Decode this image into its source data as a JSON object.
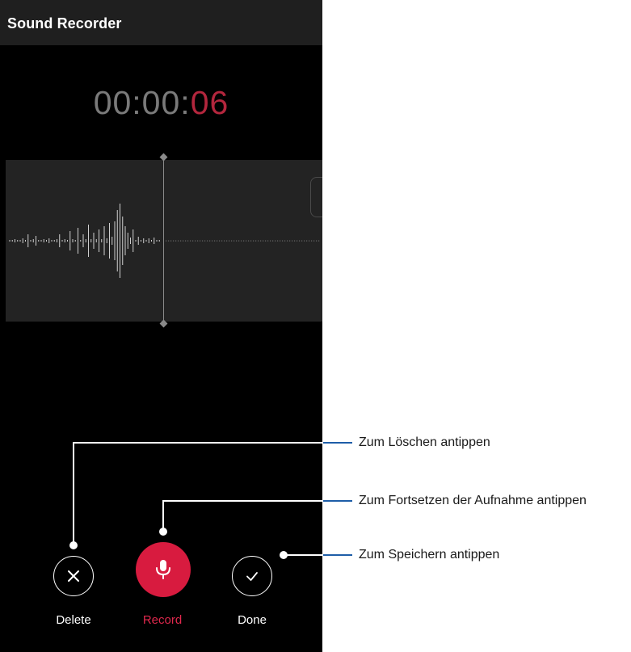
{
  "app": {
    "title": "Sound Recorder"
  },
  "timer": {
    "main": "00:00:",
    "seconds": "06"
  },
  "controls": {
    "delete_label": "Delete",
    "record_label": "Record",
    "done_label": "Done"
  },
  "callouts": {
    "delete": "Zum Löschen antippen",
    "record": "Zum Fortsetzen der Aufnahme antippen",
    "done": "Zum Speichern antippen"
  },
  "icons": {
    "delete": "close-icon",
    "record": "microphone-icon",
    "done": "check-icon"
  },
  "colors": {
    "accent": "#d81b3f",
    "timer_seconds": "#b3263d",
    "background": "#000000",
    "appbar": "#1f1f1f",
    "wave_panel": "#232323"
  }
}
